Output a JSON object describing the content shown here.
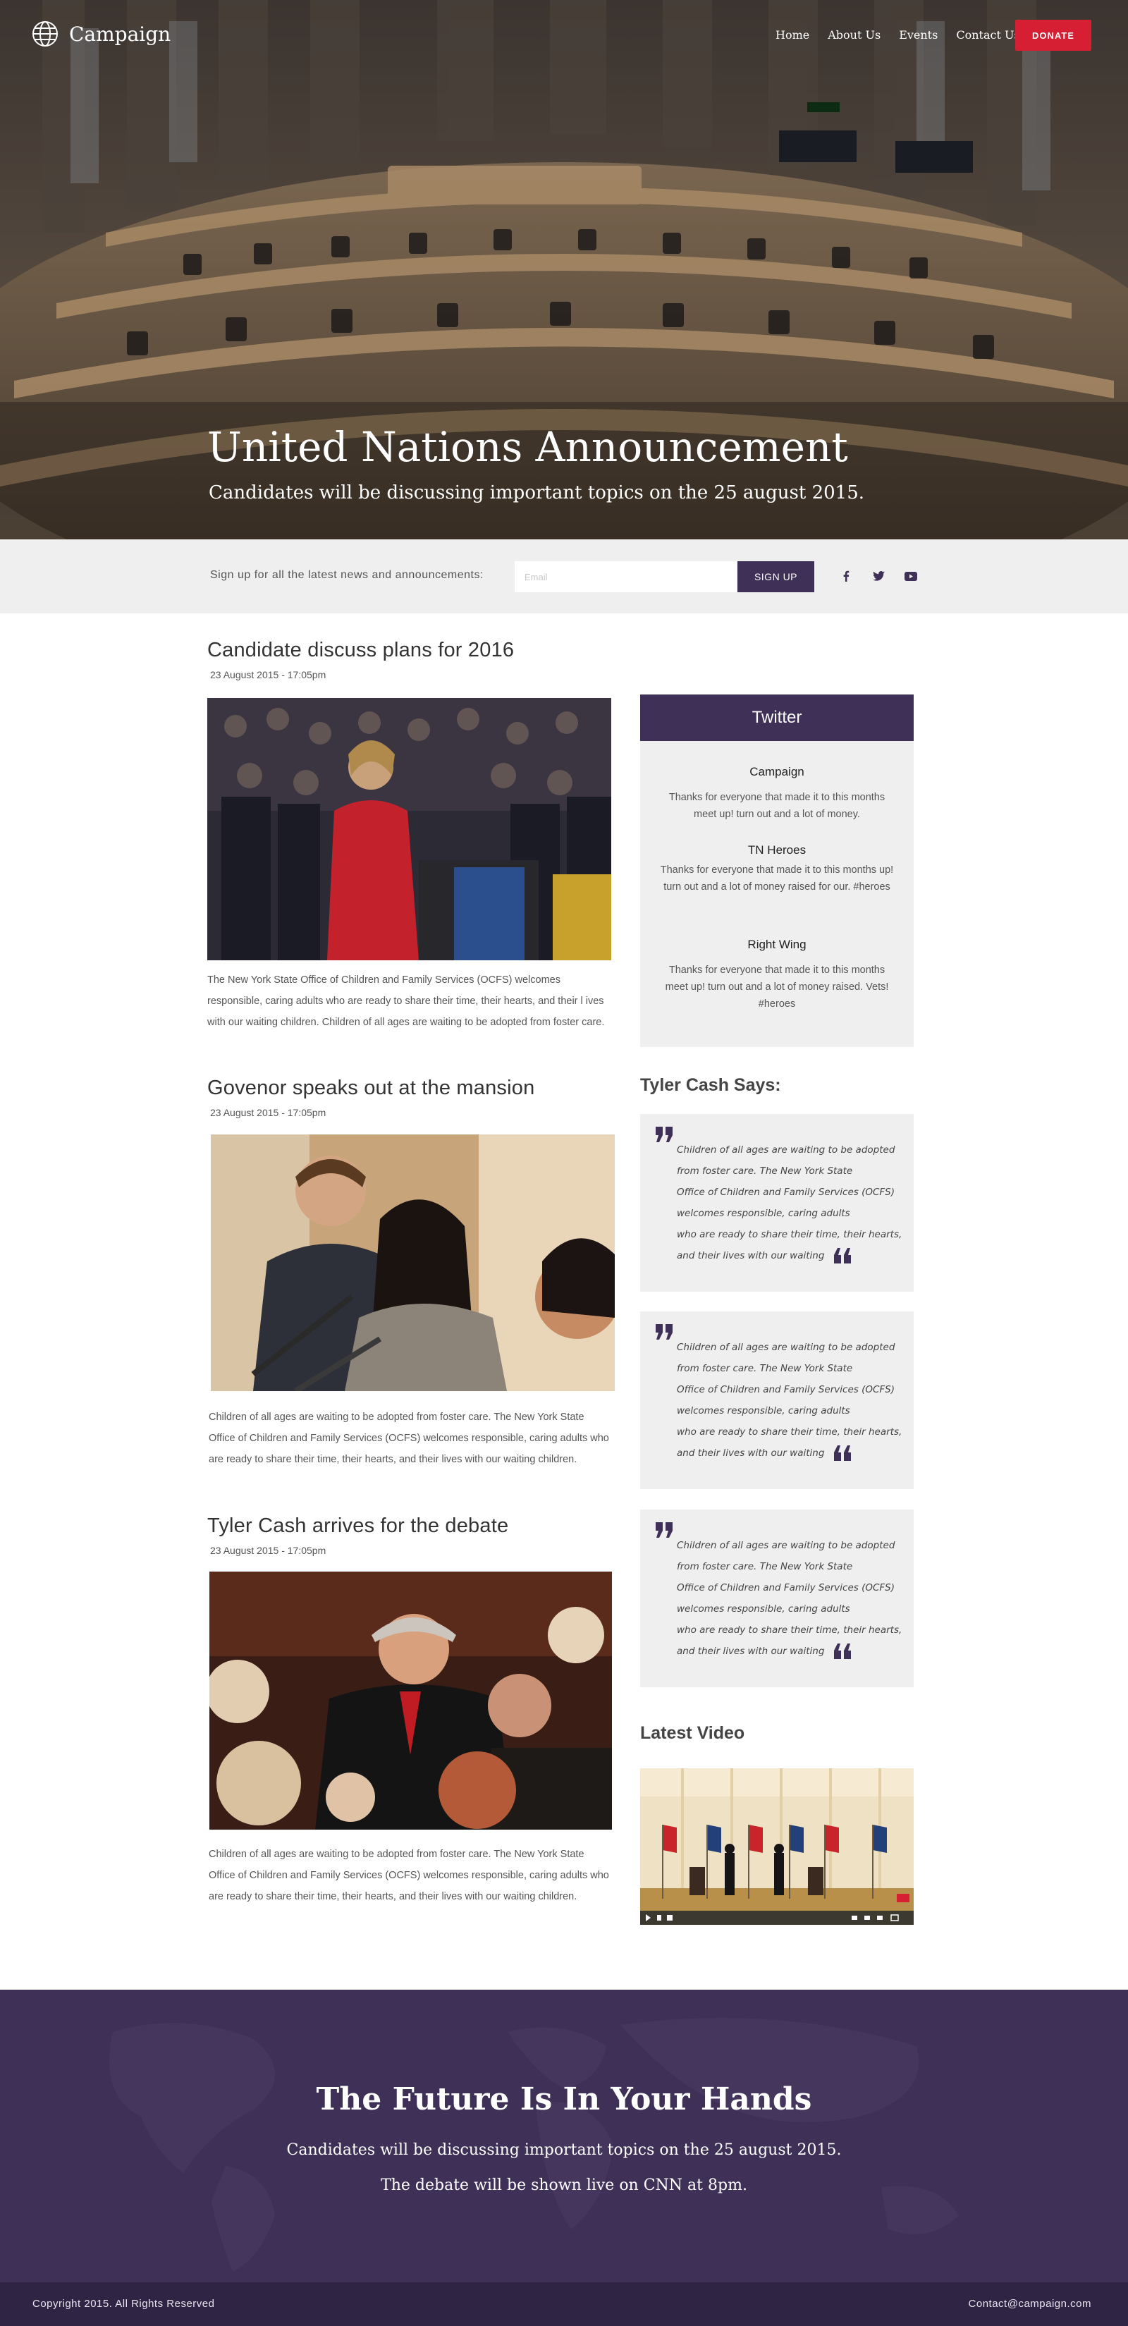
{
  "brand": {
    "name": "Campaign"
  },
  "nav": {
    "items": [
      "Home",
      "About Us",
      "Events",
      "Contact Us"
    ],
    "donate_label": "DONATE"
  },
  "hero": {
    "title": "United Nations Announcement",
    "subtitle": "Candidates will be discussing important topics on the 25 august 2015."
  },
  "signup": {
    "label": "Sign up for all the latest news and announcements:",
    "email_placeholder": "Email",
    "button_label": "SIGN UP",
    "social_icons": [
      "facebook-icon",
      "twitter-icon",
      "youtube-icon"
    ]
  },
  "articles": [
    {
      "title": "Candidate discuss plans for 2016",
      "date": "23 August 2015 - 17:05pm",
      "text": "The New York State Office of Children and Family Services (OCFS) welcomes responsible, caring adults who are ready to share their time, their hearts, and their l ives with our waiting children. Children of all ages are waiting to be adopted from foster care."
    },
    {
      "title": "Govenor speaks out at the mansion",
      "date": "23 August 2015 - 17:05pm",
      "text": "Children of all ages are waiting to be adopted from foster care. The New York State Office of Children and Family Services (OCFS) welcomes responsible, caring adults who are ready to share their time, their hearts, and their lives with our waiting children."
    },
    {
      "title": "Tyler Cash arrives for the debate",
      "date": "23 August 2015 - 17:05pm",
      "text": "Children of all ages are waiting to be adopted from foster care. The New York State Office of Children and Family Services (OCFS) welcomes responsible, caring adults who are ready to share their time, their hearts, and their lives with our waiting children."
    }
  ],
  "twitter": {
    "heading": "Twitter",
    "tweets": [
      {
        "author": "Campaign",
        "text": "Thanks for everyone that made it to this months meet up!  turn out and a lot of money."
      },
      {
        "author": "TN Heroes",
        "text": "Thanks for everyone that made it to this months up!  turn out and a lot of money raised for our. #heroes"
      },
      {
        "author": "Right Wing",
        "text": "Thanks for everyone that made it to this months meet up! turn out and a lot of money raised. Vets!  #heroes"
      }
    ]
  },
  "quotes": {
    "heading": "Tyler Cash Says:",
    "items": [
      {
        "lines": [
          "Children of all ages are waiting to be adopted",
          "from foster care. The New York State",
          "Office of Children and Family Services (OCFS)",
          "welcomes responsible, caring adults",
          "who are ready to share their time, their hearts,",
          "and their lives with our waiting"
        ]
      },
      {
        "lines": [
          "Children of all ages are waiting to be adopted",
          "from foster care. The New York State",
          "Office of Children and Family Services (OCFS)",
          "welcomes responsible, caring adults",
          "who are ready to share their time, their hearts,",
          "and their lives with our waiting"
        ]
      },
      {
        "lines": [
          "Children of all ages are waiting to be adopted",
          "from foster care. The New York State",
          "Office of Children and Family Services (OCFS)",
          "welcomes responsible, caring adults",
          "who are ready to share their time, their hearts,",
          "and their lives with our waiting"
        ]
      }
    ]
  },
  "video": {
    "heading": "Latest Video"
  },
  "cta": {
    "title": "The Future Is In Your Hands",
    "line1": "Candidates will be discussing important topics on the 25 august 2015.",
    "line2": "The debate will be shown live on CNN at 8pm."
  },
  "footer": {
    "copyright": "Copyright 2015. All Rights Reserved",
    "email": "Contact@campaign.com"
  },
  "colors": {
    "brand_purple": "#3e3056",
    "footer_purple": "#2f2443",
    "donate_red": "#d71f34",
    "panel_gray": "#efefef"
  }
}
